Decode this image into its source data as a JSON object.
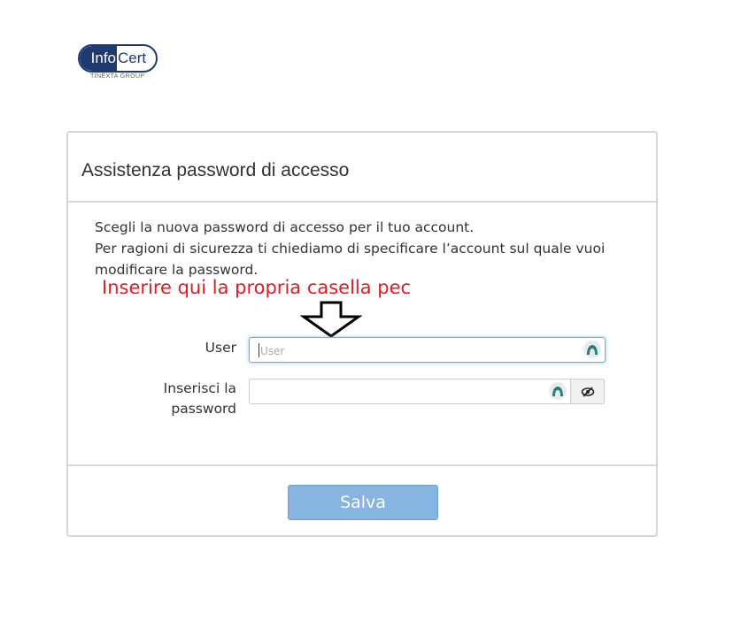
{
  "logo": {
    "part1": "Info",
    "part2": "Cert",
    "subtitle": "TINEXTA GROUP"
  },
  "panel": {
    "title": "Assistenza password di accesso",
    "description": [
      "Scegli la nuova password di accesso per il tuo account.",
      "Per ragioni di sicurezza ti chiediamo di specificare l’account sul quale vuoi",
      "modificare la password."
    ],
    "annotation": "Inserire qui la propria casella pec"
  },
  "form": {
    "user_label": "User",
    "user_placeholder": "User",
    "user_value": "",
    "password_label_line1": "Inserisci la",
    "password_label_line2": "password",
    "password_value": ""
  },
  "actions": {
    "save_label": "Salva"
  },
  "colors": {
    "brand": "#1f3a6e",
    "annotation": "#e11b22",
    "button": "#87b4e0",
    "focus": "#66afe9"
  }
}
